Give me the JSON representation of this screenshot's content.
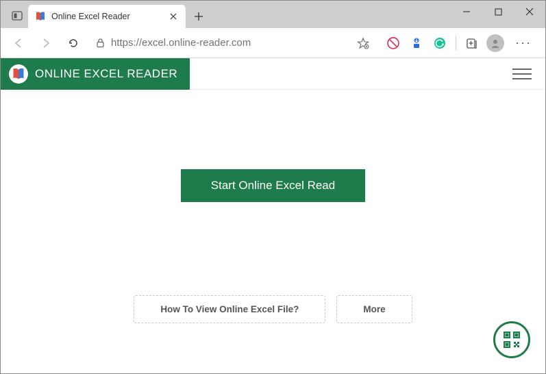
{
  "window": {
    "tab_title": "Online Excel Reader"
  },
  "address": {
    "url": "https://excel.online-reader.com"
  },
  "site": {
    "brand": "ONLINE EXCEL READER"
  },
  "hero": {
    "cta": "Start Online Excel Read"
  },
  "links": {
    "howto": "How To View Online Excel File?",
    "more": "More"
  },
  "colors": {
    "brand_green": "#1e7b4c"
  }
}
